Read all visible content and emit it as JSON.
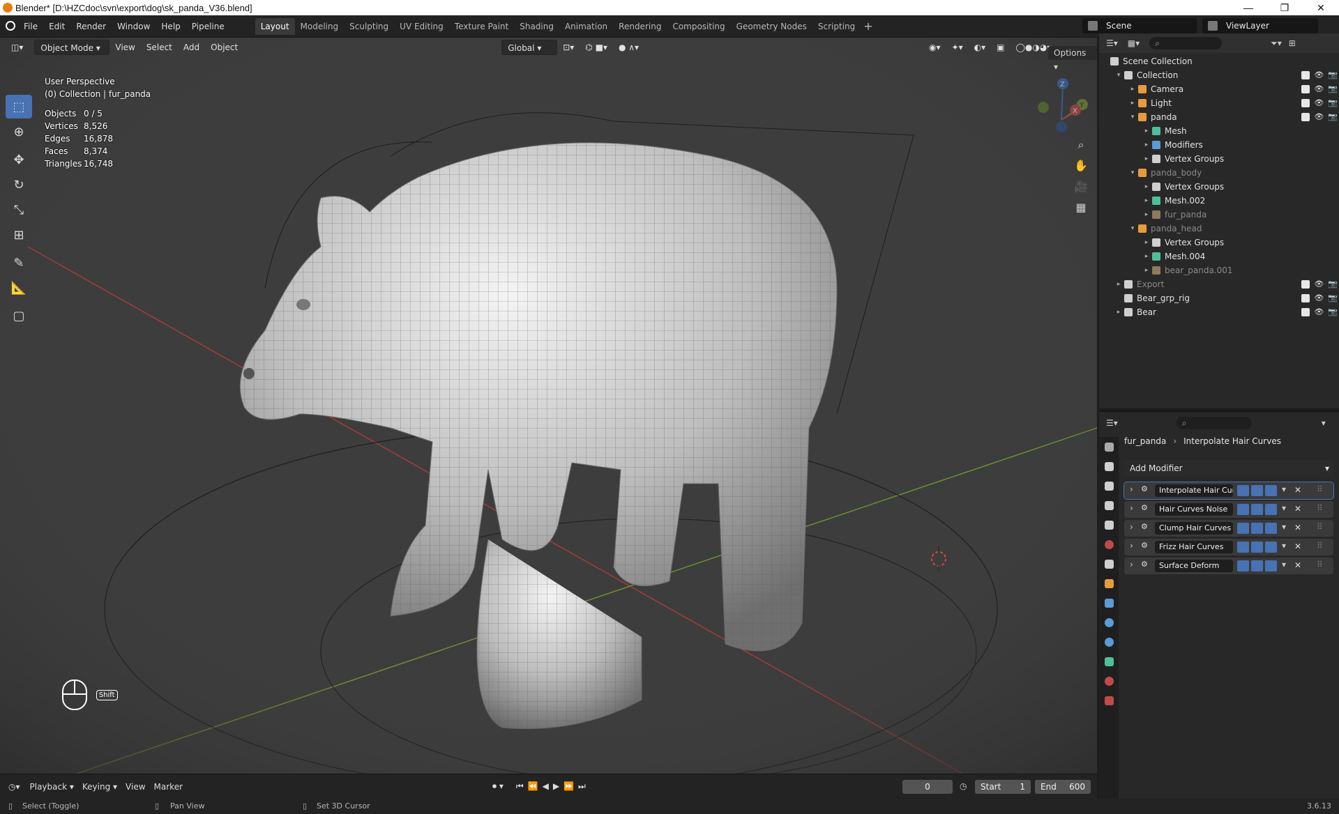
{
  "window": {
    "title": "Blender* [D:\\HZCdoc\\svn\\export\\dog\\sk_panda_V36.blend]"
  },
  "menu": [
    "File",
    "Edit",
    "Render",
    "Window",
    "Help",
    "Pipeline"
  ],
  "workspaces": [
    "Layout",
    "Modeling",
    "Sculpting",
    "UV Editing",
    "Texture Paint",
    "Shading",
    "Animation",
    "Rendering",
    "Compositing",
    "Geometry Nodes",
    "Scripting"
  ],
  "active_workspace": "Layout",
  "scene": "Scene",
  "view_layer": "ViewLayer",
  "viewport": {
    "mode": "Object Mode",
    "menus": [
      "View",
      "Select",
      "Add",
      "Object"
    ],
    "orientation": "Global",
    "options_label": "Options",
    "perspective": "User Perspective",
    "collection_info": "(0) Collection | fur_panda",
    "stats": [
      {
        "key": "Objects",
        "value": "0 / 5"
      },
      {
        "key": "Vertices",
        "value": "8,526"
      },
      {
        "key": "Edges",
        "value": "16,878"
      },
      {
        "key": "Faces",
        "value": "8,374"
      },
      {
        "key": "Triangles",
        "value": "16,748"
      }
    ],
    "shift_label": "Shift",
    "gizmo": {
      "z": "Z",
      "y": "Y",
      "x": "X"
    }
  },
  "outliner": {
    "rows": [
      {
        "label": "Scene Collection",
        "indent": 0,
        "arrow": "",
        "icon": "#cfcfcf",
        "dim": false,
        "vis": false
      },
      {
        "label": "Collection",
        "indent": 1,
        "arrow": "▾",
        "icon": "#cfcfcf",
        "dim": false,
        "vis": true
      },
      {
        "label": "Camera",
        "indent": 2,
        "arrow": "▸",
        "icon": "#e89b3c",
        "dim": false,
        "vis": true
      },
      {
        "label": "Light",
        "indent": 2,
        "arrow": "▸",
        "icon": "#e89b3c",
        "dim": false,
        "vis": true
      },
      {
        "label": "panda",
        "indent": 2,
        "arrow": "▾",
        "icon": "#e89b3c",
        "dim": false,
        "vis": true
      },
      {
        "label": "Mesh",
        "indent": 3,
        "arrow": "▸",
        "icon": "#4fbf9a",
        "dim": false,
        "vis": false
      },
      {
        "label": "Modifiers",
        "indent": 3,
        "arrow": "▸",
        "icon": "#5b9bd6",
        "dim": false,
        "vis": false
      },
      {
        "label": "Vertex Groups",
        "indent": 3,
        "arrow": "▸",
        "icon": "#cfcfcf",
        "dim": false,
        "vis": false
      },
      {
        "label": "panda_body",
        "indent": 2,
        "arrow": "▾",
        "icon": "#e89b3c",
        "dim": true,
        "vis": false
      },
      {
        "label": "Vertex Groups",
        "indent": 3,
        "arrow": "▸",
        "icon": "#cfcfcf",
        "dim": false,
        "vis": false
      },
      {
        "label": "Mesh.002",
        "indent": 3,
        "arrow": "▸",
        "icon": "#4fbf9a",
        "dim": false,
        "vis": false
      },
      {
        "label": "fur_panda",
        "indent": 3,
        "arrow": "▸",
        "icon": "#8f7a5a",
        "dim": true,
        "vis": false
      },
      {
        "label": "panda_head",
        "indent": 2,
        "arrow": "▾",
        "icon": "#e89b3c",
        "dim": true,
        "vis": false
      },
      {
        "label": "Vertex Groups",
        "indent": 3,
        "arrow": "▸",
        "icon": "#cfcfcf",
        "dim": false,
        "vis": false
      },
      {
        "label": "Mesh.004",
        "indent": 3,
        "arrow": "▸",
        "icon": "#4fbf9a",
        "dim": false,
        "vis": false
      },
      {
        "label": "bear_panda.001",
        "indent": 3,
        "arrow": "▸",
        "icon": "#8f7a5a",
        "dim": true,
        "vis": false
      },
      {
        "label": "Export",
        "indent": 1,
        "arrow": "▸",
        "icon": "#cfcfcf",
        "dim": true,
        "vis": true
      },
      {
        "label": "Bear_grp_rig",
        "indent": 1,
        "arrow": "",
        "icon": "#cfcfcf",
        "dim": false,
        "vis": true
      },
      {
        "label": "Bear",
        "indent": 1,
        "arrow": "▸",
        "icon": "#cfcfcf",
        "dim": false,
        "vis": true
      }
    ]
  },
  "properties": {
    "breadcrumb_object": "fur_panda",
    "breadcrumb_modifier": "Interpolate Hair Curves",
    "add_modifier": "Add Modifier",
    "modifiers": [
      {
        "name": "Interpolate Hair Cur...",
        "active": true
      },
      {
        "name": "Hair Curves Noise",
        "active": false
      },
      {
        "name": "Clump Hair Curves",
        "active": false
      },
      {
        "name": "Frizz Hair Curves",
        "active": false
      },
      {
        "name": "Surface Deform",
        "active": false
      }
    ]
  },
  "timeline": {
    "menus": [
      "Playback",
      "Keying",
      "View",
      "Marker"
    ],
    "current_frame": "0",
    "start_label": "Start",
    "start": "1",
    "end_label": "End",
    "end": "600"
  },
  "status": {
    "select": "Select (Toggle)",
    "pan": "Pan View",
    "cursor": "Set 3D Cursor",
    "version": "3.6.13"
  },
  "colors": {
    "accent": "#4772b3",
    "x_axis": "#b8403f",
    "y_axis": "#7fa03a",
    "z_axis": "#3a74c8"
  }
}
